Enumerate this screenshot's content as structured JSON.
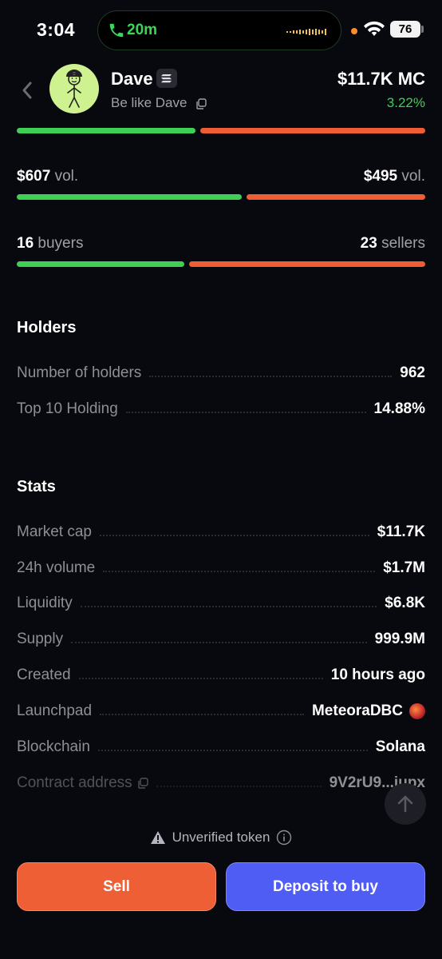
{
  "status_bar": {
    "time": "3:04",
    "call_duration": "20m",
    "battery": "76"
  },
  "token": {
    "name": "Dave",
    "subtitle": "Be like Dave",
    "market_cap": "$11.7K MC",
    "change": "3.22%"
  },
  "colors": {
    "buy_green": "#3fcf55",
    "sell_red": "#ee5d34",
    "buy_button": "#4f5df5",
    "sell_button": "#ee5f36"
  },
  "ratios": {
    "price_bar_buy_fraction": 0.44,
    "volume_buy_fraction": 0.55,
    "buyers_fraction": 0.41
  },
  "volume": {
    "buy_amount": "$607",
    "sell_amount": "$495",
    "unit": "vol."
  },
  "traders": {
    "buyers_count": "16",
    "buyers_label": "buyers",
    "sellers_count": "23",
    "sellers_label": "sellers"
  },
  "holders": {
    "title": "Holders",
    "rows": [
      {
        "label": "Number of holders",
        "value": "962"
      },
      {
        "label": "Top 10 Holding",
        "value": "14.88%"
      }
    ]
  },
  "stats": {
    "title": "Stats",
    "rows": [
      {
        "label": "Market cap",
        "value": "$11.7K"
      },
      {
        "label": "24h volume",
        "value": "$1.7M"
      },
      {
        "label": "Liquidity",
        "value": "$6.8K"
      },
      {
        "label": "Supply",
        "value": "999.9M"
      },
      {
        "label": "Created",
        "value": "10 hours ago"
      },
      {
        "label": "Launchpad",
        "value": "MeteoraDBC"
      },
      {
        "label": "Blockchain",
        "value": "Solana"
      },
      {
        "label": "Contract address",
        "value": "9V2rU9...iupx"
      }
    ]
  },
  "footer": {
    "warning": "Unverified token",
    "sell_label": "Sell",
    "buy_label": "Deposit to buy"
  }
}
